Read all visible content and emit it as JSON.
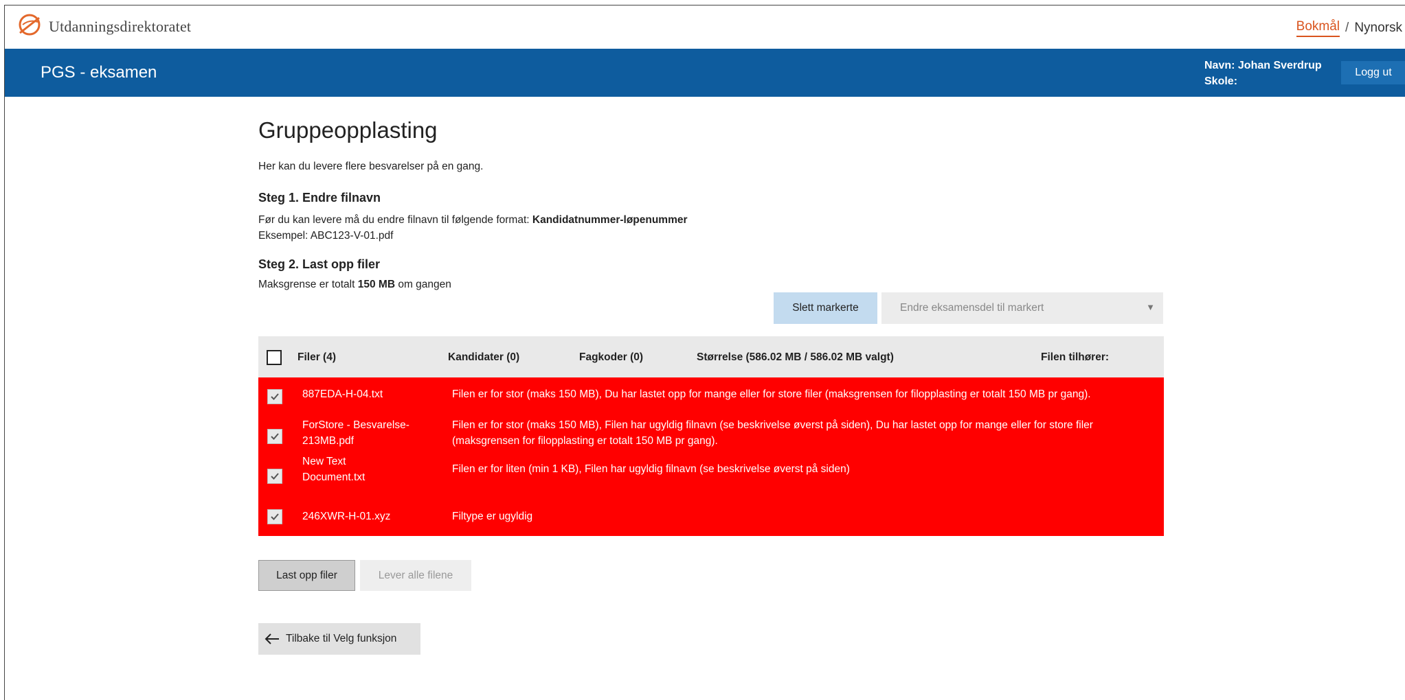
{
  "brand": {
    "name": "Utdanningsdirektoratet"
  },
  "language": {
    "active": "Bokmål",
    "separator": "/",
    "other": "Nynorsk"
  },
  "header": {
    "app_title": "PGS - eksamen",
    "user_name_line": "Navn: Johan Sverdrup",
    "school_line": "Skole:",
    "logout_label": "Logg ut"
  },
  "page": {
    "title": "Gruppeopplasting",
    "intro": "Her kan du levere flere besvarelser på en gang.",
    "step1_heading": "Steg 1. Endre filnavn",
    "step1_text_prefix": "Før du kan levere må du endre filnavn til følgende format: ",
    "step1_format": "Kandidatnummer-løpenummer",
    "step1_example": "Eksempel: ABC123-V-01.pdf",
    "step2_heading": "Steg 2. Last opp filer",
    "step2_prefix": "Maksgrense er totalt ",
    "step2_limit": "150 MB",
    "step2_suffix": " om gangen"
  },
  "actions": {
    "delete_selected": "Slett markerte",
    "change_part_placeholder": "Endre eksamensdel til markert"
  },
  "table": {
    "headers": {
      "files": "Filer (4)",
      "candidates": "Kandidater (0)",
      "subject_codes": "Fagkoder (0)",
      "size": "Størrelse (586.02 MB / 586.02 MB valgt)",
      "belongs_to": "Filen tilhører:"
    },
    "rows": [
      {
        "file": "887EDA-H-04.txt",
        "checked": true,
        "error": "Filen er for stor (maks 150 MB), Du har lastet opp for mange eller for store filer (maksgrensen for filopplasting er totalt 150 MB pr gang)."
      },
      {
        "file": "ForStore - Besvarelse-213MB.pdf",
        "checked": true,
        "error": "Filen er for stor (maks 150 MB), Filen har ugyldig filnavn (se beskrivelse øverst på siden), Du har lastet opp for mange eller for store filer (maksgrensen for filopplasting er totalt 150 MB pr gang)."
      },
      {
        "file": "New Text Document.txt",
        "checked": true,
        "error": "Filen er for liten (min 1 KB), Filen har ugyldig filnavn (se beskrivelse øverst på siden)"
      },
      {
        "file": "246XWR-H-01.xyz",
        "checked": true,
        "error": "Filtype er ugyldig"
      }
    ]
  },
  "buttons": {
    "upload": "Last opp filer",
    "deliver_all": "Lever alle filene",
    "back": "Tilbake til Velg funksjon"
  },
  "colors": {
    "brand_blue": "#0e5c9e",
    "logout_blue": "#1d6fb3",
    "accent_orange": "#d9541e",
    "error_red": "#ff0000",
    "selected_button": "#c3dbef"
  },
  "icons": {
    "logo": "udir-logo-icon",
    "checkbox_checked": "checkmark-icon",
    "back": "arrow-left-icon",
    "dropdown": "caret-down-icon"
  }
}
